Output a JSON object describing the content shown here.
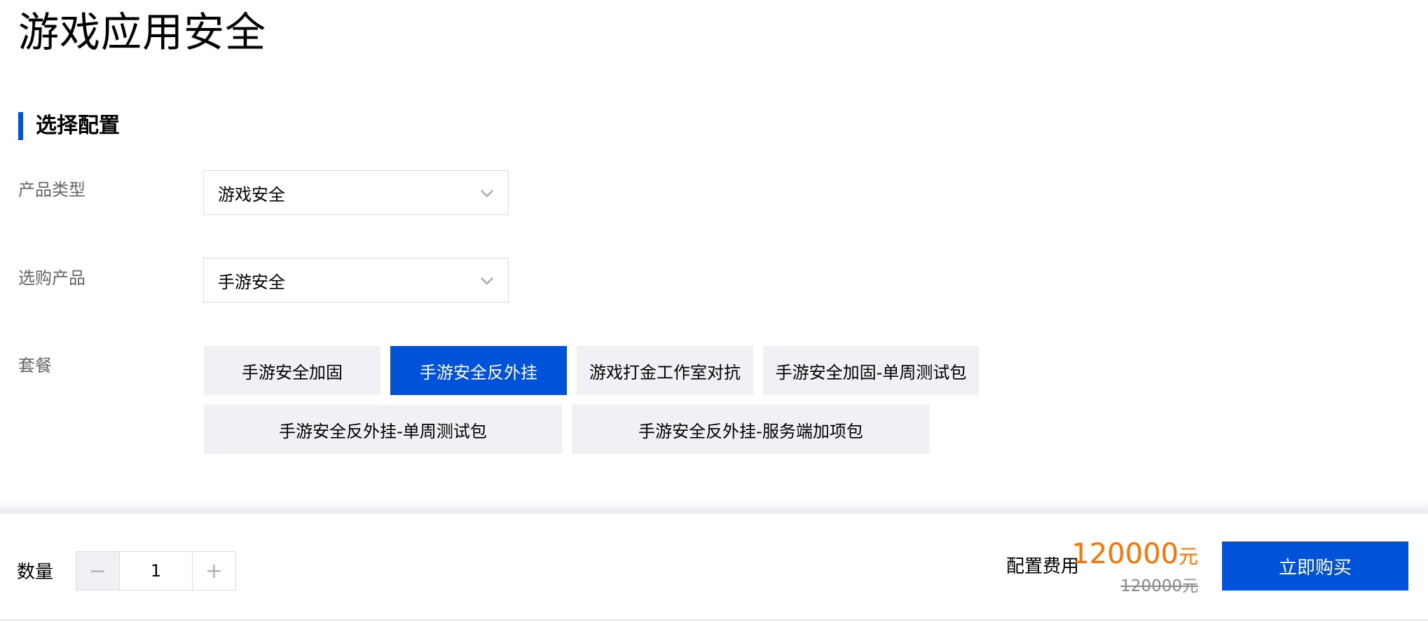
{
  "page": {
    "title": "游戏应用安全"
  },
  "section": {
    "title": "选择配置"
  },
  "form": {
    "product_type": {
      "label": "产品类型",
      "value": "游戏安全"
    },
    "product": {
      "label": "选购产品",
      "value": "手游安全"
    },
    "plan": {
      "label": "套餐",
      "selected": "手游安全反外挂",
      "options": [
        "手游安全加固",
        "手游安全反外挂",
        "游戏打金工作室对抗",
        "手游安全加固-单周测试包",
        "手游安全反外挂-单周测试包",
        "手游安全反外挂-服务端加项包"
      ]
    }
  },
  "footer": {
    "quantity_label": "数量",
    "quantity_value": "1",
    "minus_symbol": "−",
    "plus_symbol": "+",
    "fee_label": "配置费用",
    "price": "120000",
    "price_unit": "元",
    "original_price": "120000元",
    "buy_label": "立即购买"
  },
  "colors": {
    "accent": "#0052d9",
    "price": "#ff7200",
    "button_bg": "#f0f1f4"
  },
  "icons": {
    "dropdown": "chevron-down-icon"
  }
}
